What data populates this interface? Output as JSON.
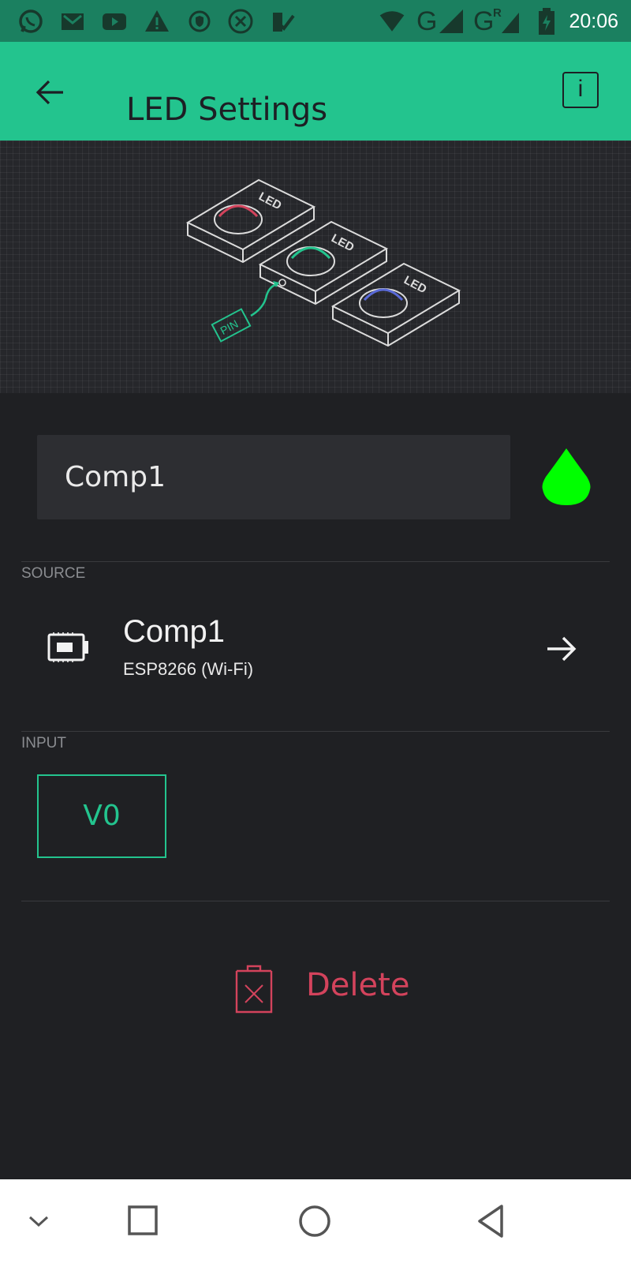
{
  "status_bar": {
    "time": "20:06",
    "network_label_1": "G",
    "network_label_2": "G",
    "network_roaming": "R",
    "left_icons": [
      "whatsapp-icon",
      "gmail-icon",
      "youtube-icon",
      "warning-icon",
      "vpn-shield-icon",
      "cancel-circle-icon",
      "task-check-icon"
    ],
    "right_icons": [
      "wifi-icon",
      "signal-icon",
      "battery-charging-icon"
    ]
  },
  "app_bar": {
    "title": "LED Settings",
    "info_label": "i"
  },
  "hero": {
    "led_labels": [
      "LED",
      "LED",
      "LED"
    ],
    "pin_label": "PIN",
    "led_colors": [
      "#d3435c",
      "#23c48e",
      "#5a6ad8"
    ]
  },
  "name_field": {
    "value": "Comp1"
  },
  "color_picker": {
    "color": "#00ff00"
  },
  "source": {
    "section_label": "SOURCE",
    "device_name": "Comp1",
    "device_type": "ESP8266 (Wi-Fi)"
  },
  "input": {
    "section_label": "INPUT",
    "pin": "V0"
  },
  "delete": {
    "label": "Delete"
  },
  "colors": {
    "accent": "#23c48e",
    "status_bar": "#1b8060",
    "background": "#1f2023",
    "delete": "#d3435c"
  }
}
